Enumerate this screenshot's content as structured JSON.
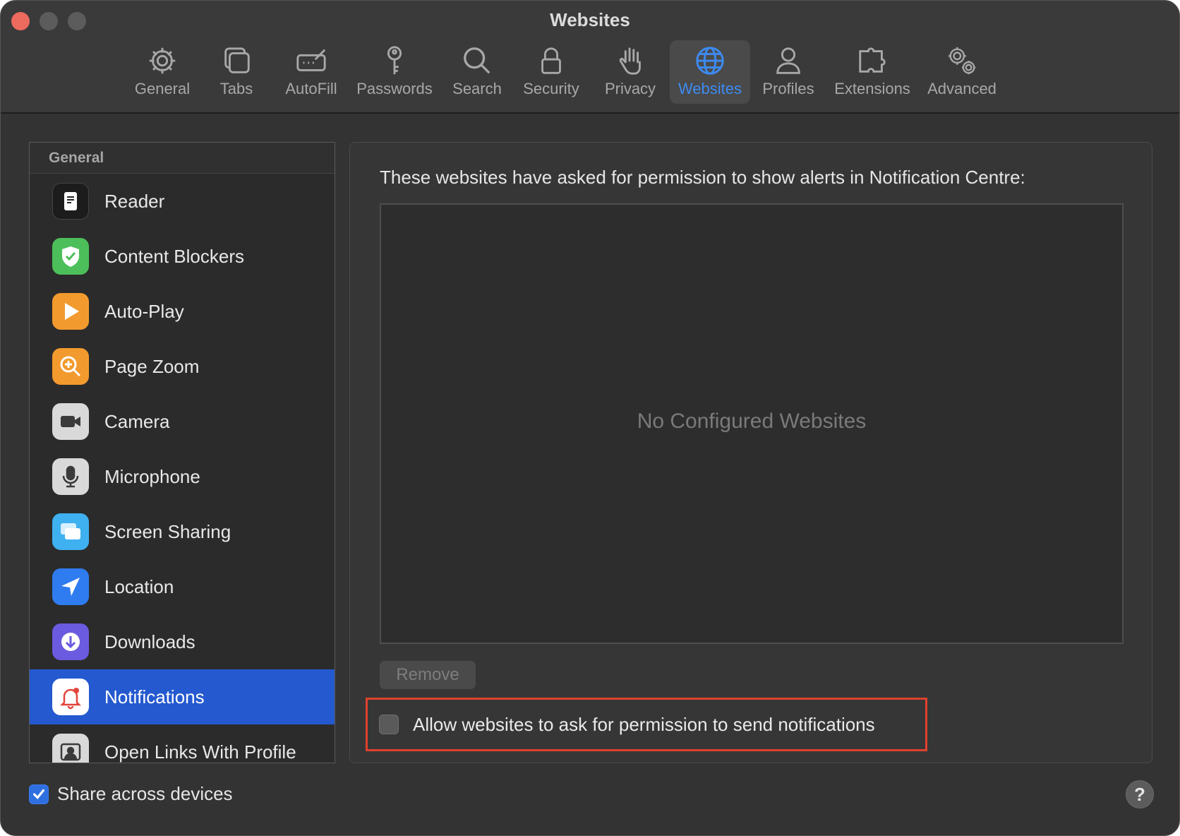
{
  "window": {
    "title": "Websites"
  },
  "toolbar": {
    "items": [
      {
        "label": "General",
        "icon": "gear-icon",
        "active": false
      },
      {
        "label": "Tabs",
        "icon": "tabs-icon",
        "active": false
      },
      {
        "label": "AutoFill",
        "icon": "autofill-icon",
        "active": false
      },
      {
        "label": "Passwords",
        "icon": "key-icon",
        "active": false
      },
      {
        "label": "Search",
        "icon": "search-icon",
        "active": false
      },
      {
        "label": "Security",
        "icon": "lock-icon",
        "active": false
      },
      {
        "label": "Privacy",
        "icon": "hand-icon",
        "active": false
      },
      {
        "label": "Websites",
        "icon": "globe-icon",
        "active": true
      },
      {
        "label": "Profiles",
        "icon": "person-icon",
        "active": false
      },
      {
        "label": "Extensions",
        "icon": "puzzle-icon",
        "active": false
      },
      {
        "label": "Advanced",
        "icon": "gears-icon",
        "active": false
      }
    ]
  },
  "sidebar": {
    "header": "General",
    "items": [
      {
        "label": "Reader",
        "icon": "reader-icon",
        "color": "#1c1c1c"
      },
      {
        "label": "Content Blockers",
        "icon": "shield-check-icon",
        "color": "#4cbf5a"
      },
      {
        "label": "Auto-Play",
        "icon": "play-icon",
        "color": "#f29a2e"
      },
      {
        "label": "Page Zoom",
        "icon": "zoom-icon",
        "color": "#f29a2e"
      },
      {
        "label": "Camera",
        "icon": "camera-icon",
        "color": "#d9d9d9"
      },
      {
        "label": "Microphone",
        "icon": "microphone-icon",
        "color": "#d9d9d9"
      },
      {
        "label": "Screen Sharing",
        "icon": "screen-sharing-icon",
        "color": "#3fb0f0"
      },
      {
        "label": "Location",
        "icon": "location-arrow-icon",
        "color": "#2f7cf0"
      },
      {
        "label": "Downloads",
        "icon": "download-icon",
        "color": "#6a5be0"
      },
      {
        "label": "Notifications",
        "icon": "bell-icon",
        "color": "#ffffff",
        "selected": true
      },
      {
        "label": "Open Links With Profile",
        "icon": "profile-card-icon",
        "color": "#d9d9d9"
      }
    ]
  },
  "panel": {
    "description": "These websites have asked for permission to show alerts in Notification Centre:",
    "empty_text": "No Configured Websites",
    "remove_label": "Remove",
    "allow_label": "Allow websites to ask for permission to send notifications",
    "allow_checked": false
  },
  "footer": {
    "share_label": "Share across devices",
    "share_checked": true,
    "help_label": "?"
  },
  "colors": {
    "accent": "#3d8bf2",
    "selection": "#2459cf",
    "highlight_border": "#e0412e"
  }
}
